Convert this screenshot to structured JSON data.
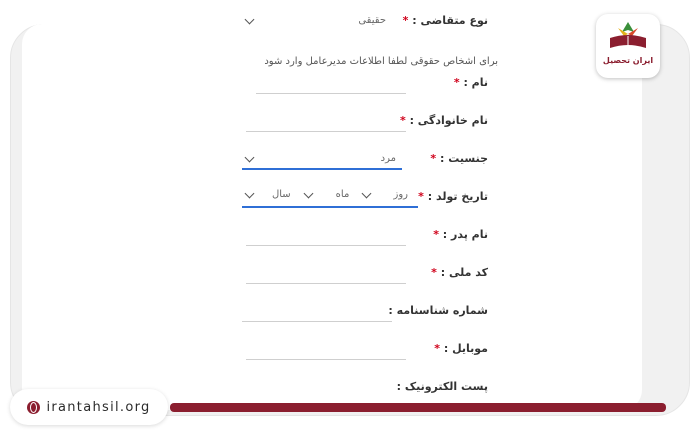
{
  "branding": {
    "logo_text": "ایران تحصیل",
    "site": "irantahsil.org",
    "accent_color": "#8b1e2f"
  },
  "form": {
    "applicant_type": {
      "label": "نوع متقاضی :",
      "value": "حقیقی"
    },
    "info_text": "برای اشخاص حقوقی لطفا اطلاعات مدیرعامل وارد شود",
    "first_name": {
      "label": "نام :"
    },
    "last_name": {
      "label": "نام خانوادگی :"
    },
    "gender": {
      "label": "جنسیت :",
      "value": "مرد"
    },
    "birth_date": {
      "label": "تاریخ تولد :",
      "day": "روز",
      "month": "ماه",
      "year": "سال"
    },
    "father_name": {
      "label": "نام پدر :"
    },
    "national_code": {
      "label": "کد ملی :"
    },
    "id_number": {
      "label": "شماره شناسنامه :"
    },
    "mobile": {
      "label": "موبایل :"
    },
    "email": {
      "label": "پست الکترونیک :"
    }
  },
  "required_mark": "*",
  "focus_color": "#2f6fd6"
}
